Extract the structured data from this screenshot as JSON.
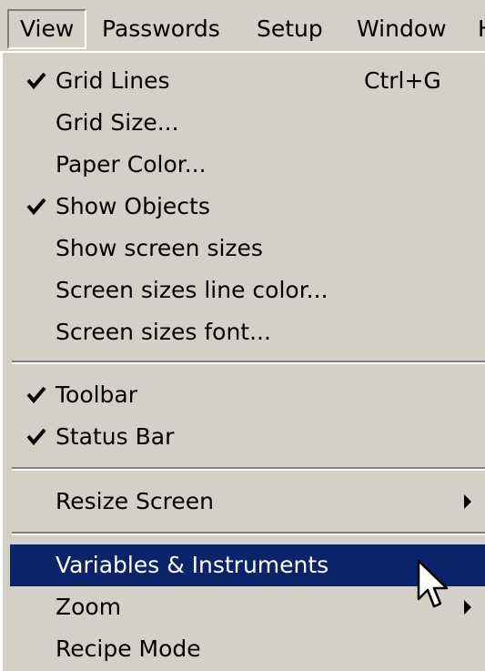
{
  "menubar": {
    "items": [
      {
        "label": "View"
      },
      {
        "label": "Passwords"
      },
      {
        "label": "Setup"
      },
      {
        "label": "Window"
      },
      {
        "label": "H"
      }
    ]
  },
  "view_menu": {
    "items": [
      {
        "label": "Grid Lines",
        "shortcut": "Ctrl+G",
        "checked": true
      },
      {
        "label": "Grid Size...",
        "checked": false
      },
      {
        "label": "Paper Color...",
        "checked": false
      },
      {
        "label": "Show Objects",
        "checked": true
      },
      {
        "label": "Show screen sizes",
        "checked": false
      },
      {
        "label": "Screen sizes line color...",
        "checked": false
      },
      {
        "label": "Screen sizes font...",
        "checked": false
      },
      {
        "label": "Toolbar",
        "checked": true
      },
      {
        "label": "Status Bar",
        "checked": true
      },
      {
        "label": "Resize Screen",
        "submenu": true
      },
      {
        "label": "Variables & Instruments",
        "highlighted": true
      },
      {
        "label": "Zoom",
        "submenu": true
      },
      {
        "label": "Recipe Mode"
      }
    ]
  },
  "colors": {
    "menu_background": "#d4d0c8",
    "highlight_background": "#0a246a",
    "highlight_text": "#ffffff"
  }
}
